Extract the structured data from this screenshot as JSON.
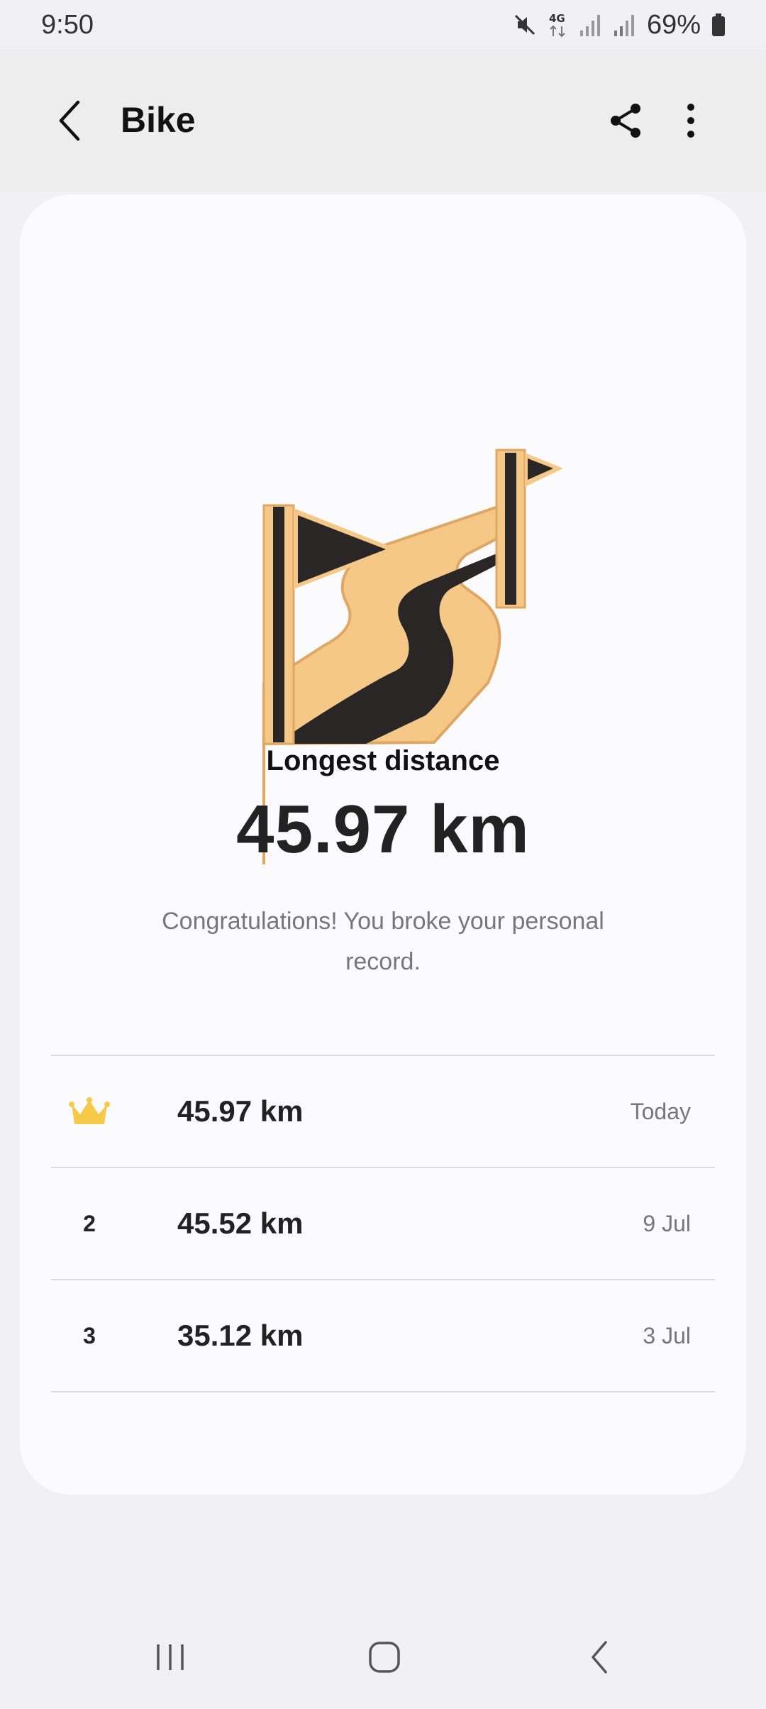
{
  "status_bar": {
    "time": "9:50",
    "network": "4G",
    "battery": "69%",
    "icons": [
      "mute-icon",
      "network-4g-icon",
      "signal-icon",
      "signal-icon",
      "battery-icon"
    ]
  },
  "app_bar": {
    "title": "Bike",
    "icons": [
      "back-arrow-icon",
      "share-icon",
      "more-vertical-icon"
    ]
  },
  "record": {
    "badge_icon": "winding-road-flags-badge",
    "label": "Longest distance",
    "value": "45.97 km",
    "message": "Congratulations! You broke your personal record."
  },
  "history": [
    {
      "rank": "",
      "rank_icon": "crown-icon",
      "distance": "45.97 km",
      "date": "Today"
    },
    {
      "rank": "2",
      "distance": "45.52 km",
      "date": "9 Jul"
    },
    {
      "rank": "3",
      "distance": "35.12 km",
      "date": "3 Jul"
    }
  ],
  "nav_bar": {
    "icons": [
      "recent-apps-icon",
      "home-icon",
      "back-icon"
    ]
  },
  "colors": {
    "badge_gold": "#f6c888",
    "badge_dark": "#2a2626",
    "crown": "#f7c948",
    "background": "#f1f1f3",
    "card": "#fbfbfd"
  }
}
